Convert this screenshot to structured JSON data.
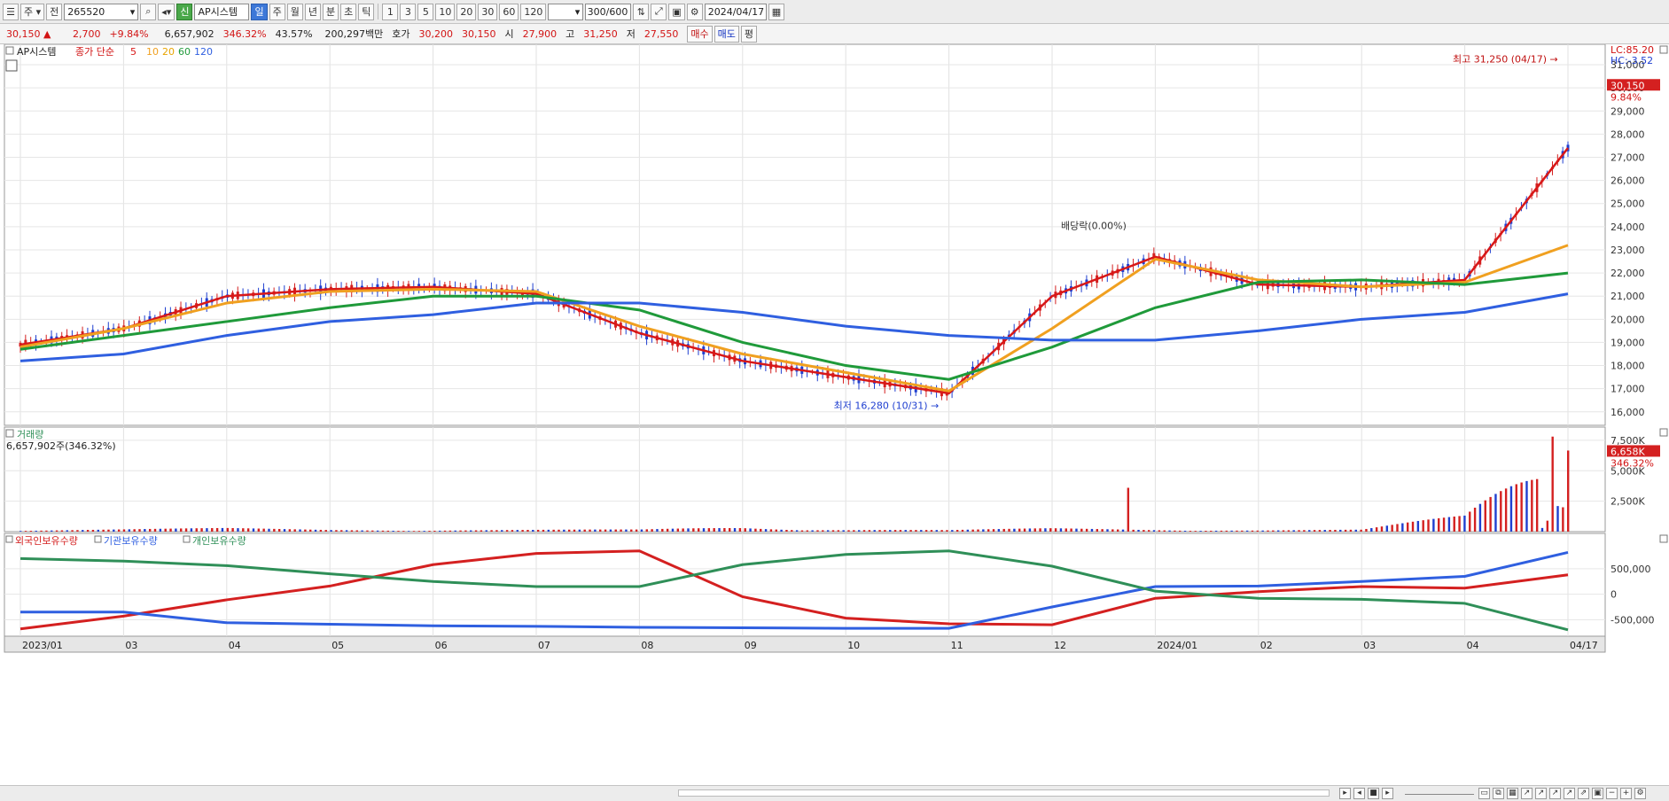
{
  "toolbar": {
    "period_dropdown": "주",
    "market_label": "전",
    "code_value": "265520",
    "stock_badge": "신",
    "stock_name": "AP시스템",
    "timeframes": [
      "일",
      "주",
      "월",
      "년",
      "분",
      "초",
      "틱"
    ],
    "active_timeframe": "일",
    "multipliers": [
      "1",
      "3",
      "5",
      "10",
      "20",
      "30",
      "60",
      "120"
    ],
    "bar_count": "300/600",
    "date_value": "2024/04/17"
  },
  "quote": {
    "price": "30,150",
    "arrow": "▲",
    "change": "2,700",
    "change_pct": "+9.84%",
    "volume": "6,657,902",
    "volume_ratio": "346.32%",
    "turnover": "43.57%",
    "amount": "200,297백만",
    "ask_label": "호가",
    "ask1": "30,200",
    "ask2": "30,150",
    "open_label": "시",
    "open": "27,900",
    "high_label": "고",
    "high": "31,250",
    "low_label": "저",
    "low": "27,550",
    "buy_label": "매수",
    "sell_label": "매도",
    "eval_label": "평"
  },
  "price_panel": {
    "name": "AP시스템",
    "ma_label": "종가 단순",
    "ma_periods": [
      "5",
      "10",
      "20",
      "60",
      "120"
    ],
    "ma_colors": [
      "#d81818",
      "#f0a020",
      "#e8a400",
      "#1f9a3a",
      "#2f5fe0"
    ],
    "yticks": [
      "31,000",
      "30,000",
      "29,000",
      "28,000",
      "27,000",
      "26,000",
      "25,000",
      "24,000",
      "23,000",
      "22,000",
      "21,000",
      "20,000",
      "19,000",
      "18,000",
      "17,000",
      "16,000"
    ],
    "lc": "LC:85.20",
    "hc": "HC:-3.52",
    "last_price": "30,150",
    "last_pct": "9.84%",
    "high_note": "최고 31,250 (04/17) →",
    "low_note": "최저 16,280 (10/31) →",
    "dividend_note": "배당락(0.00%)"
  },
  "volume_panel": {
    "name": "거래량",
    "value_line": "6,657,902주(346.32%)",
    "yticks": [
      "7,500K",
      "5,000K",
      "2,500K"
    ],
    "last_value": "6,658K",
    "last_pct": "346.32%"
  },
  "holdings_panel": {
    "series": [
      "외국인보유수량",
      "기관보유수량",
      "개인보유수량"
    ],
    "colors": [
      "#d42020",
      "#2f5fe0",
      "#2f8f58"
    ],
    "yticks": [
      "500,000",
      "0",
      "-500,000"
    ]
  },
  "xaxis": {
    "labels": [
      "2023/01",
      "03",
      "04",
      "05",
      "06",
      "07",
      "08",
      "09",
      "10",
      "11",
      "12",
      "2024/01",
      "02",
      "03",
      "04",
      "04/17"
    ]
  },
  "chart_data": [
    {
      "type": "line",
      "title": "AP시스템",
      "note": "daily candlestick price chart with simple moving averages",
      "x": [
        "2023/01",
        "03",
        "04",
        "05",
        "06",
        "07",
        "08",
        "09",
        "10",
        "11",
        "12",
        "2024/01",
        "02",
        "03",
        "04",
        "04/17"
      ],
      "series": [
        {
          "name": "5",
          "values": [
            18900,
            19600,
            21000,
            21300,
            21400,
            21100,
            19400,
            18200,
            17500,
            16800,
            21000,
            22700,
            21500,
            21400,
            21700,
            27400
          ]
        },
        {
          "name": "20",
          "values": [
            18800,
            19600,
            20700,
            21200,
            21300,
            21200,
            19700,
            18500,
            17700,
            16900,
            19600,
            22600,
            21700,
            21400,
            21600,
            23200
          ]
        },
        {
          "name": "60",
          "values": [
            18700,
            19300,
            19900,
            20500,
            21000,
            21000,
            20400,
            19000,
            18000,
            17400,
            18800,
            20500,
            21600,
            21700,
            21500,
            22000
          ]
        },
        {
          "name": "120",
          "values": [
            18200,
            18500,
            19300,
            19900,
            20200,
            20700,
            20700,
            20300,
            19700,
            19300,
            19100,
            19100,
            19500,
            20000,
            20300,
            21100
          ]
        }
      ],
      "ylim": [
        15800,
        31500
      ],
      "annotations": {
        "high": "최고 31,250 (04/17)",
        "low": "최저 16,280 (10/31)"
      }
    },
    {
      "type": "bar",
      "title": "거래량",
      "x": [
        "2023/01",
        "03",
        "04",
        "05",
        "06",
        "07",
        "08",
        "09",
        "10",
        "11",
        "12",
        "2024/01",
        "02",
        "03",
        "04",
        "04/17"
      ],
      "series": [
        {
          "name": "거래량",
          "values": [
            120,
            150,
            200,
            120,
            110,
            110,
            120,
            300,
            140,
            90,
            200,
            150,
            90,
            110,
            1000,
            6658
          ]
        }
      ],
      "ylim": [
        0,
        8000
      ]
    },
    {
      "type": "line",
      "x": [
        "2023/01",
        "03",
        "04",
        "05",
        "06",
        "07",
        "08",
        "09",
        "10",
        "11",
        "12",
        "2024/01",
        "02",
        "03",
        "04",
        "04/17"
      ],
      "series": [
        {
          "name": "외국인보유수량",
          "values": [
            -680000,
            -430000,
            -110000,
            160000,
            580000,
            800000,
            850000,
            -50000,
            -470000,
            -580000,
            -600000,
            -80000,
            50000,
            150000,
            120000,
            380000
          ]
        },
        {
          "name": "기관보유수량",
          "values": [
            -350000,
            -350000,
            -560000,
            -590000,
            -620000,
            -630000,
            -650000,
            -660000,
            -670000,
            -670000,
            -250000,
            150000,
            160000,
            250000,
            350000,
            820000
          ]
        },
        {
          "name": "개인보유수량",
          "values": [
            700000,
            650000,
            560000,
            400000,
            250000,
            150000,
            150000,
            580000,
            780000,
            850000,
            550000,
            60000,
            -80000,
            -100000,
            -180000,
            -700000
          ]
        }
      ],
      "ylim": [
        -720000,
        950000
      ]
    }
  ]
}
